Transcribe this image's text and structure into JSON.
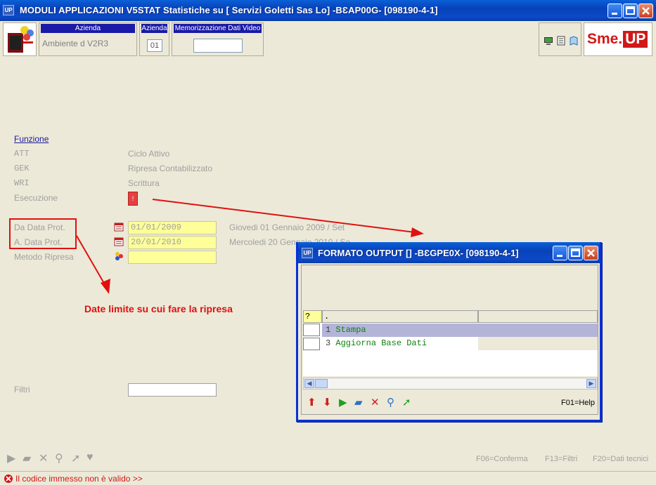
{
  "window": {
    "icon": "UP",
    "title": "MODULI APPLICAZIONI V5STAT Statistiche su [ Servizi Goletti Sas Lo] -BƐAP00G- [098190-4-1]",
    "minimize_label": "_",
    "maximize_label": "□",
    "close_label": "✕"
  },
  "header": {
    "azienda_label": "Azienda",
    "azienda_value": "Ambiente d V2R3",
    "azienda_code_label": "Azienda",
    "azienda_code_value": "01",
    "memo_label": "Memorizzazione Dati Video",
    "memo_value": "",
    "brand_text": "Sme.",
    "brand_up": "UP"
  },
  "form": {
    "funzione_label": "Funzione",
    "rows": [
      {
        "code": "ATT",
        "desc": "Ciclo Attivo"
      },
      {
        "code": "GEK",
        "desc": "Ripresa Contabilizzato"
      },
      {
        "code": "WRI",
        "desc": "Scrittura"
      }
    ],
    "esecuzione_label": "Esecuzione",
    "esecuzione_button": "!",
    "da_data_label": "Da Data Prot.",
    "da_data_value": "01/01/2009",
    "da_data_desc": "Giovedi 01 Gennaio 2009 / Set",
    "a_data_label": "A. Data Prot.",
    "a_data_value": "20/01/2010",
    "a_data_desc": "Mercoledi 20 Gennaio 2010 / Se",
    "metodo_label": "Metodo Ripresa",
    "metodo_value": "",
    "filtri_label": "Filtri",
    "filtri_value": ""
  },
  "annotation": {
    "text": "Date limite su cui fare la ripresa",
    "color": "#e01010"
  },
  "function_keys": [
    {
      "label": "F06=Conferma"
    },
    {
      "label": "F13=Filtri"
    },
    {
      "label": "F20=Dati tecnici"
    }
  ],
  "status": {
    "message": "Il codice immesso non è valido >>"
  },
  "dialog": {
    "icon": "UP",
    "title": "FORMATO OUTPUT [] -BƐGPE0X- [098190-4-1]",
    "grid_headers": [
      "?",
      "."
    ],
    "rows": [
      {
        "num": "1",
        "label": "Stampa",
        "selected": true
      },
      {
        "num": "3",
        "label": "Aggiorna Base Dati",
        "selected": false
      }
    ],
    "help_label": "F01=Help"
  }
}
